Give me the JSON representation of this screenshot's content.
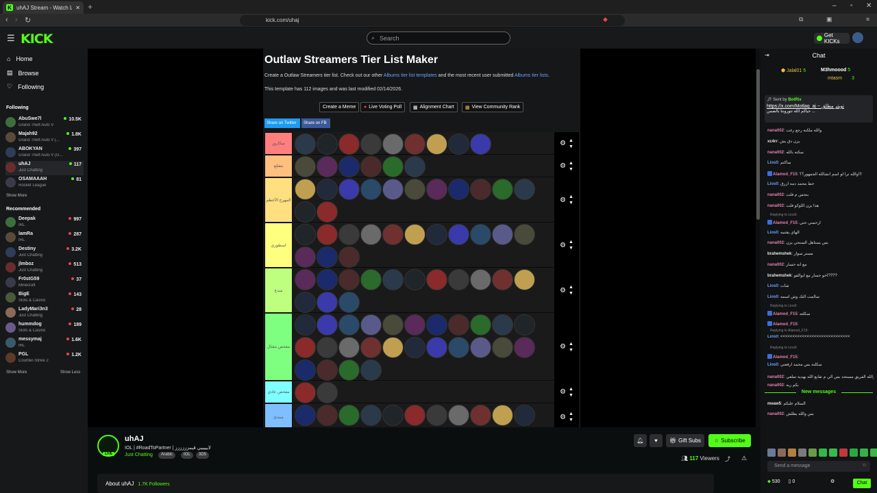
{
  "browser": {
    "tab_title": "uhAJ Stream - Watch Live on Ki",
    "url": "kick.com/uhaj"
  },
  "header": {
    "search_placeholder": "Search",
    "get_kicks": "Get KICKs",
    "logo": "KICK"
  },
  "sidebar": {
    "nav": [
      "Home",
      "Browse",
      "Following"
    ],
    "following_head": "Following",
    "following": [
      {
        "name": "AbuSwe7l",
        "cat": "Grand Theft Auto V",
        "viewers": "10.5K",
        "live": true
      },
      {
        "name": "Majah92",
        "cat": "Grand Theft Auto V (...",
        "viewers": "1.8K",
        "live": true
      },
      {
        "name": "ABOKYAN",
        "cat": "Grand Theft Auto V (G...",
        "viewers": "397",
        "live": true
      },
      {
        "name": "uhAJ",
        "cat": "Just Chatting",
        "viewers": "117",
        "live": true
      },
      {
        "name": "OSAMAAAH",
        "cat": "Rocket League",
        "viewers": "81",
        "live": true
      }
    ],
    "show_more": "Show More",
    "recommended_head": "Recommended",
    "recommended": [
      {
        "name": "Deepak",
        "cat": "IRL",
        "viewers": "997"
      },
      {
        "name": "lamRa",
        "cat": "IRL",
        "viewers": "287"
      },
      {
        "name": "Destiny",
        "cat": "Just Chatting",
        "viewers": "3.2K"
      },
      {
        "name": "jlmboz",
        "cat": "Just Chatting",
        "viewers": "513"
      },
      {
        "name": "Fr0stG59",
        "cat": "Minecraft",
        "viewers": "37"
      },
      {
        "name": "BigE",
        "cat": "Slots & Casino",
        "viewers": "143"
      },
      {
        "name": "LadyMari3n3",
        "cat": "Just Chatting",
        "viewers": "28"
      },
      {
        "name": "hummdog",
        "cat": "Slots & Casino",
        "viewers": "189"
      },
      {
        "name": "messymaj",
        "cat": "IRL",
        "viewers": "1.6K"
      },
      {
        "name": "PGL",
        "cat": "Counter-Strike 2",
        "viewers": "1.2K"
      }
    ],
    "show_more2": "Show More",
    "show_less": "Show Less"
  },
  "tierpage": {
    "title": "Outlaw Streamers Tier List Maker",
    "desc_a": "Create a Outlaw Streamers tier list. Check out our other ",
    "desc_link1": "Albums tier list templates",
    "desc_b": " and the most recent user submitted ",
    "desc_link2": "Albums tier lists",
    "desc_c": ".",
    "meta": "This template has 112 images and was last modified 02/14/2026.",
    "buttons": [
      "Create a Meme",
      "Live Voting Poll",
      "Alignment Chart",
      "View Community Rank"
    ],
    "share_twitter": "Share on Twitter",
    "share_fb": "Share on FB",
    "tiers": [
      {
        "label": "سكاروز",
        "color": "#ff7f7f",
        "count": 9
      },
      {
        "label": "مقتلع",
        "color": "#ffbf7f",
        "count": 6
      },
      {
        "label": "المهرج الأعظم",
        "color": "#ffdf7f",
        "count": 13
      },
      {
        "label": "اسطوري",
        "color": "#ffff7f",
        "count": 14
      },
      {
        "label": "مبدع",
        "color": "#bfff7f",
        "count": 14
      },
      {
        "label": "مفحص مقتال",
        "color": "#7fff7f",
        "count": 26
      },
      {
        "label": "مفحص عادي",
        "color": "#7fffff",
        "count": 2
      },
      {
        "label": "مبتدئ",
        "color": "#7fbfff",
        "count": 12
      }
    ]
  },
  "streamer": {
    "name": "uhAJ",
    "title": "IOL | #RoadToPartner | لايييييي قيمزززززز",
    "category": "Just Chatting",
    "tags": [
      "Arabic",
      "IOL",
      "3D5"
    ],
    "live": "LIVE",
    "gift": "Gift Subs",
    "subscribe": "Subscribe",
    "viewers_num": "117",
    "viewers_label": "Viewers",
    "about": "About uhAJ",
    "followers": "1.7K Followers"
  },
  "chat": {
    "title": "Chat",
    "leaders": [
      {
        "name": "Jalal01",
        "n": "5"
      },
      {
        "name": "M3hmoood",
        "n": "5"
      },
      {
        "name": "mtasm",
        "n": "3"
      }
    ],
    "pinned_by": "Sent by",
    "pinned_user": "BotRix",
    "pinned_text": "https://x.com/Motlaq_aj ~ تويتر مطلق",
    "pinned_text2": "حياكم الله تتوروننا بالضمن ...",
    "messages": [
      {
        "u": "nana002",
        "c": "#e27fb0",
        "t": "والله ملكنه رجع رغت"
      },
      {
        "u": "xc4rr",
        "c": "#e6e6e6",
        "t": "يزن دق يش"
      },
      {
        "u": "nana002",
        "c": "#e27fb0",
        "t": "سكته بالله"
      },
      {
        "u": "Lios0",
        "c": "#6aa2ff",
        "t": "ساكتم"
      },
      {
        "u": "Alamod_F15",
        "c": "#e27fb0",
        "t": "والله ترا لو اسم انشالله الجمهور؟؟!!!",
        "bd": true
      },
      {
        "u": "Lios0",
        "c": "#6aa2ff",
        "t": "حط محمد دمه ازرق"
      },
      {
        "u": "nana002",
        "c": "#e27fb0",
        "t": "بنحس م فلت"
      },
      {
        "u": "nana002",
        "c": "#e27fb0",
        "t": "هذا يزن اللوكو فلت"
      },
      {
        "u": "Alamod_F15",
        "c": "#e27fb0",
        "t": "ارحمني حتي",
        "bd": true
      },
      {
        "u": "Lios0",
        "c": "#6aa2ff",
        "t": "الهاي يقتنيه"
      },
      {
        "u": "nana002",
        "c": "#e27fb0",
        "t": "بس يستاهل السنحي يزن"
      },
      {
        "u": "brahemshek",
        "c": "#e6e6e6",
        "t": "مستر سوار"
      },
      {
        "u": "nana002",
        "c": "#e27fb0",
        "t": "مع انه حسار"
      },
      {
        "u": "brahemshek",
        "c": "#e6e6e6",
        "t": "اخو حسار مع ابوالقو????"
      },
      {
        "u": "Lios0",
        "c": "#6aa2ff",
        "t": "شات"
      },
      {
        "u": "Lios0",
        "c": "#6aa2ff",
        "t": "سالمت التك وش اسمه"
      },
      {
        "u": "Alamod_F15",
        "c": "#e27fb0",
        "t": "سكلته",
        "bd": true
      },
      {
        "u": "Alamod_F15",
        "c": "#e27fb0",
        "t": "",
        "bd": true
      },
      {
        "u": "Lios0",
        "c": "#6aa2ff",
        "t": "<<<<<<<<<<<<<<<<<<<<<<<<<<<<<"
      },
      {
        "u": "Alamod_F15",
        "c": "#e27fb0",
        "t": "",
        "bd": true
      },
      {
        "u": "Lios0",
        "c": "#6aa2ff",
        "t": "سكلته بس محمد ارفعني"
      },
      {
        "u": "nana002",
        "c": "#e27fb0",
        "t": "والله الفريق مستحد بس الي م تقابع الله يهديه تملعي"
      },
      {
        "u": "nana002",
        "c": "#e27fb0",
        "t": "بكم ربه"
      }
    ],
    "replies": [
      "Replying to Lios0:",
      "Replying to Lios0:",
      "Replying to Alamod_F15:",
      "Replying to Lios0:"
    ],
    "new_messages": "New messages",
    "after": [
      {
        "u": "meaw5",
        "c": "#e6e6e6",
        "t": "السلام عليكم"
      },
      {
        "u": "nana002",
        "c": "#e27fb0",
        "t": "بس والله يطلش"
      }
    ],
    "input_placeholder": "Send a message",
    "points": "530",
    "zero": "0",
    "send": "Chat"
  }
}
